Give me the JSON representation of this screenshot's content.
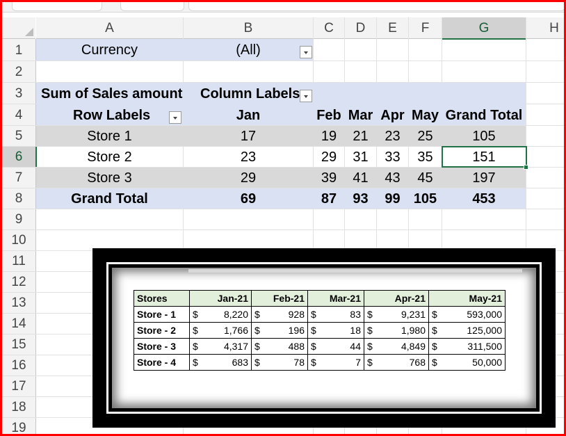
{
  "columns": [
    "A",
    "B",
    "C",
    "D",
    "E",
    "F",
    "G",
    "H"
  ],
  "rows": [
    "1",
    "2",
    "3",
    "4",
    "5",
    "6",
    "7",
    "8",
    "9",
    "10",
    "11",
    "12",
    "13",
    "14",
    "15",
    "16",
    "17",
    "18",
    "19"
  ],
  "pivot": {
    "filter_label": "Currency",
    "filter_value": "(All)",
    "sum_label": "Sum of Sales amount",
    "column_labels": "Column Labels",
    "row_labels": "Row Labels",
    "months": [
      "Jan",
      "Feb",
      "Mar",
      "Apr",
      "May"
    ],
    "grand_total_header": "Grand Total",
    "stores": [
      {
        "name": "Store 1",
        "values": [
          "17",
          "19",
          "21",
          "23",
          "25"
        ],
        "total": "105"
      },
      {
        "name": "Store 2",
        "values": [
          "23",
          "29",
          "31",
          "33",
          "35"
        ],
        "total": "151"
      },
      {
        "name": "Store 3",
        "values": [
          "29",
          "39",
          "41",
          "43",
          "45"
        ],
        "total": "197"
      }
    ],
    "grand_total_row": {
      "label": "Grand Total",
      "values": [
        "69",
        "87",
        "93",
        "99",
        "105"
      ],
      "total": "453"
    }
  },
  "embedded_table": {
    "headers": [
      "Stores",
      "Jan-21",
      "Feb-21",
      "Mar-21",
      "Apr-21",
      "May-21"
    ],
    "currency_symbol": "$",
    "rows": [
      {
        "store": "Store - 1",
        "values": [
          "8,220",
          "928",
          "83",
          "9,231",
          "593,000"
        ]
      },
      {
        "store": "Store - 2",
        "values": [
          "1,766",
          "196",
          "18",
          "1,980",
          "125,000"
        ]
      },
      {
        "store": "Store - 3",
        "values": [
          "4,317",
          "488",
          "44",
          "4,849",
          "311,500"
        ]
      },
      {
        "store": "Store - 4",
        "values": [
          "683",
          "78",
          "7",
          "768",
          "50,000"
        ]
      }
    ]
  },
  "colors": {
    "accent": "#217346",
    "pivot_header": "#d9e1f2",
    "band": "#d9d9d9",
    "frame": "#ff0000"
  }
}
